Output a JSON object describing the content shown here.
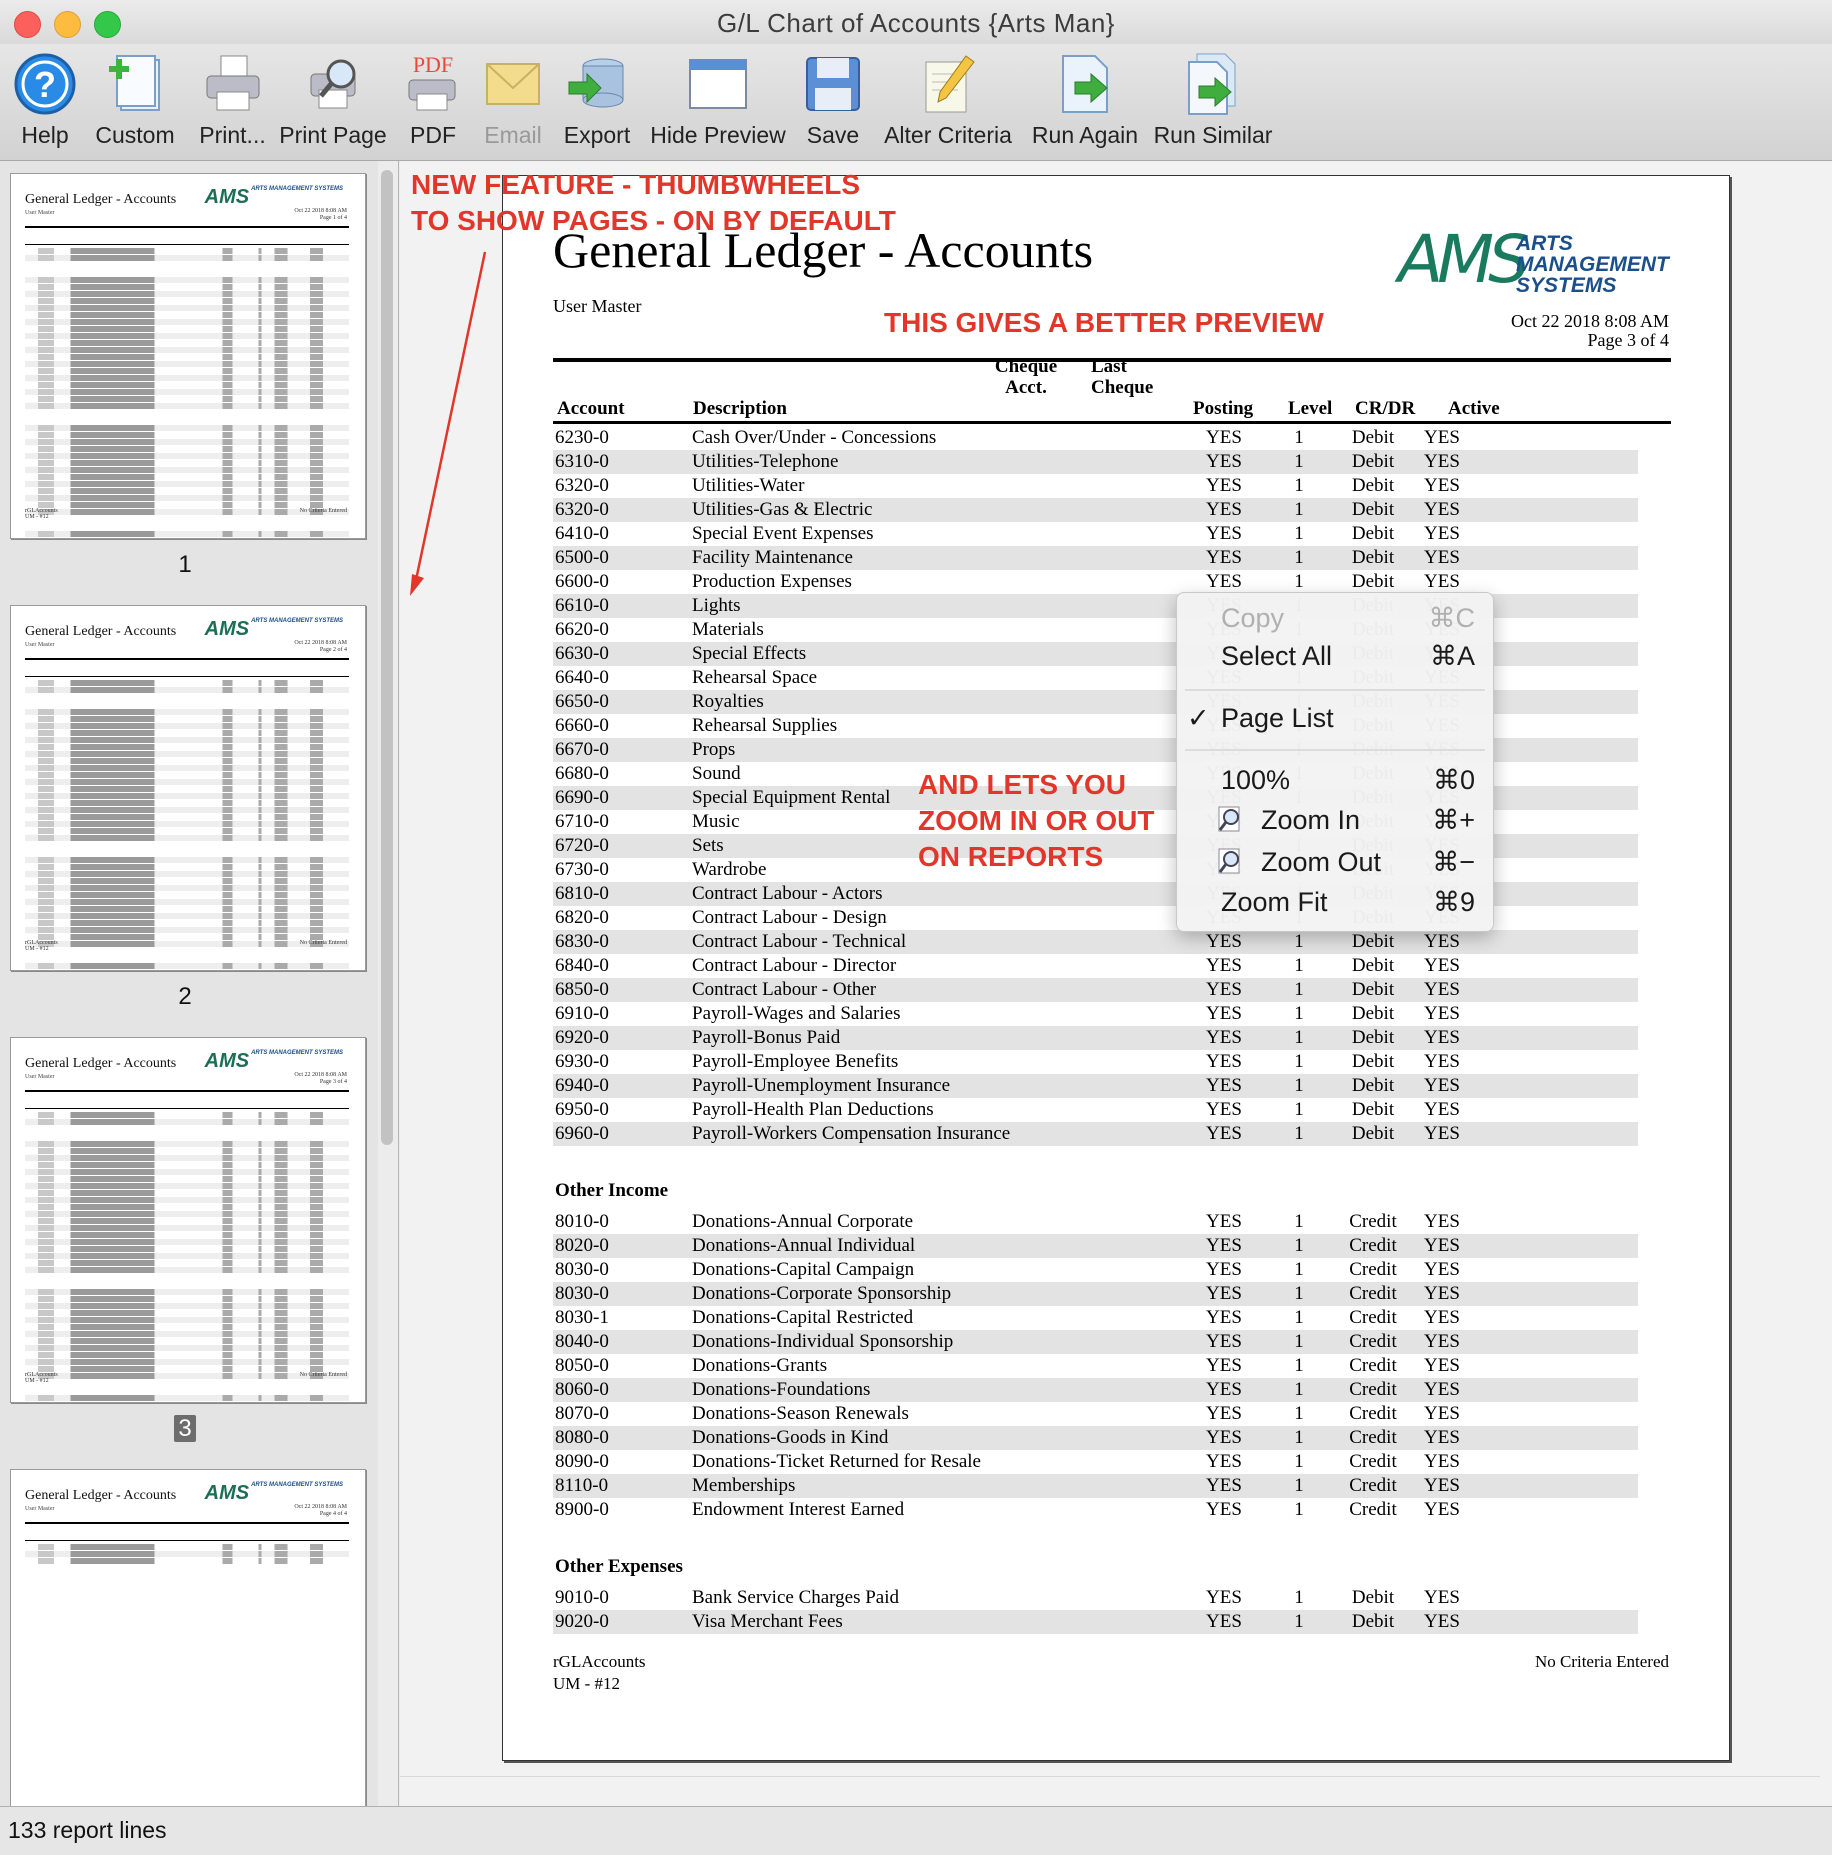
{
  "window": {
    "title": "G/L Chart of Accounts {Arts Man}",
    "traffic_colors": [
      "#fc605c",
      "#fdbc40",
      "#34c84a"
    ]
  },
  "toolbar": [
    {
      "label": "Help",
      "icon": "help-icon"
    },
    {
      "label": "Custom",
      "icon": "custom-icon"
    },
    {
      "label": "Print...",
      "icon": "printer-icon"
    },
    {
      "label": "Print Page",
      "icon": "print-page-icon"
    },
    {
      "label": "PDF",
      "icon": "pdf-icon"
    },
    {
      "label": "Email",
      "icon": "email-icon",
      "disabled": true
    },
    {
      "label": "Export",
      "icon": "export-icon"
    },
    {
      "label": "Hide Preview",
      "icon": "hide-preview-icon"
    },
    {
      "label": "Save",
      "icon": "save-icon"
    },
    {
      "label": "Alter Criteria",
      "icon": "alter-criteria-icon"
    },
    {
      "label": "Run Again",
      "icon": "run-again-icon"
    },
    {
      "label": "Run Similar",
      "icon": "run-similar-icon"
    }
  ],
  "thumbnails": {
    "title": "General Ledger - Accounts",
    "subtitle": "User Master",
    "logo_text": "AMS",
    "logo_words": "ARTS MANAGEMENT SYSTEMS",
    "footer_left": "rGLAccounts",
    "footer_left2": "UM - #12",
    "footer_right": "No Criteria Entered",
    "pages": [
      {
        "number": "1",
        "date": "Oct 22 2018 8:08 AM",
        "page_label": "Page 1 of 4"
      },
      {
        "number": "2",
        "date": "Oct 22 2018 8:08 AM",
        "page_label": "Page 2 of 4"
      },
      {
        "number": "3",
        "date": "Oct 22 2018 8:08 AM",
        "page_label": "Page 3 of 4",
        "selected": true
      },
      {
        "number": "4",
        "date": "Oct 22 2018 8:08 AM",
        "page_label": "Page 4 of 4"
      }
    ]
  },
  "report": {
    "title": "General Ledger - Accounts",
    "subtitle": "User Master",
    "logo_mark": "AMS",
    "logo_words": [
      "ARTS",
      "MANAGEMENT",
      "SYSTEMS"
    ],
    "date": "Oct 22 2018 8:08 AM",
    "page": "Page 3 of 4",
    "columns": {
      "account": "Account",
      "description": "Description",
      "cheque_acct_1": "Cheque",
      "cheque_acct_2": "Acct.",
      "last_cheque_1": "Last",
      "last_cheque_2": "Cheque",
      "posting": "Posting",
      "level": "Level",
      "crdr": "CR/DR",
      "active": "Active"
    },
    "sections": [
      {
        "name": "",
        "rows": [
          [
            "6230-0",
            "Cash Over/Under - Concessions",
            "YES",
            "1",
            "Debit",
            "YES"
          ],
          [
            "6310-0",
            "Utilities-Telephone",
            "YES",
            "1",
            "Debit",
            "YES"
          ],
          [
            "6320-0",
            "Utilities-Water",
            "YES",
            "1",
            "Debit",
            "YES"
          ],
          [
            "6320-0",
            "Utilities-Gas & Electric",
            "YES",
            "1",
            "Debit",
            "YES"
          ],
          [
            "6410-0",
            "Special Event Expenses",
            "YES",
            "1",
            "Debit",
            "YES"
          ],
          [
            "6500-0",
            "Facility Maintenance",
            "YES",
            "1",
            "Debit",
            "YES"
          ],
          [
            "6600-0",
            "Production Expenses",
            "YES",
            "1",
            "Debit",
            "YES"
          ],
          [
            "6610-0",
            "Lights",
            "YES",
            "1",
            "Debit",
            "YES"
          ],
          [
            "6620-0",
            "Materials",
            "YES",
            "1",
            "Debit",
            "YES"
          ],
          [
            "6630-0",
            "Special Effects",
            "YES",
            "1",
            "Debit",
            "YES"
          ],
          [
            "6640-0",
            "Rehearsal Space",
            "YES",
            "1",
            "Debit",
            "YES"
          ],
          [
            "6650-0",
            "Royalties",
            "YES",
            "1",
            "Debit",
            "YES"
          ],
          [
            "6660-0",
            "Rehearsal Supplies",
            "YES",
            "1",
            "Debit",
            "YES"
          ],
          [
            "6670-0",
            "Props",
            "YES",
            "1",
            "Debit",
            "YES"
          ],
          [
            "6680-0",
            "Sound",
            "YES",
            "1",
            "Debit",
            "YES"
          ],
          [
            "6690-0",
            "Special Equipment Rental",
            "YES",
            "1",
            "Debit",
            "YES"
          ],
          [
            "6710-0",
            "Music",
            "YES",
            "1",
            "Debit",
            "YES"
          ],
          [
            "6720-0",
            "Sets",
            "YES",
            "1",
            "Debit",
            "YES"
          ],
          [
            "6730-0",
            "Wardrobe",
            "YES",
            "1",
            "Debit",
            "YES"
          ],
          [
            "6810-0",
            "Contract Labour - Actors",
            "YES",
            "1",
            "Debit",
            "YES"
          ],
          [
            "6820-0",
            "Contract Labour - Design",
            "YES",
            "1",
            "Debit",
            "YES"
          ],
          [
            "6830-0",
            "Contract Labour - Technical",
            "YES",
            "1",
            "Debit",
            "YES"
          ],
          [
            "6840-0",
            "Contract Labour - Director",
            "YES",
            "1",
            "Debit",
            "YES"
          ],
          [
            "6850-0",
            "Contract Labour - Other",
            "YES",
            "1",
            "Debit",
            "YES"
          ],
          [
            "6910-0",
            "Payroll-Wages and Salaries",
            "YES",
            "1",
            "Debit",
            "YES"
          ],
          [
            "6920-0",
            "Payroll-Bonus Paid",
            "YES",
            "1",
            "Debit",
            "YES"
          ],
          [
            "6930-0",
            "Payroll-Employee Benefits",
            "YES",
            "1",
            "Debit",
            "YES"
          ],
          [
            "6940-0",
            "Payroll-Unemployment Insurance",
            "YES",
            "1",
            "Debit",
            "YES"
          ],
          [
            "6950-0",
            "Payroll-Health Plan Deductions",
            "YES",
            "1",
            "Debit",
            "YES"
          ],
          [
            "6960-0",
            "Payroll-Workers Compensation Insurance",
            "YES",
            "1",
            "Debit",
            "YES"
          ]
        ]
      },
      {
        "name": "Other Income",
        "rows": [
          [
            "8010-0",
            "Donations-Annual Corporate",
            "YES",
            "1",
            "Credit",
            "YES"
          ],
          [
            "8020-0",
            "Donations-Annual Individual",
            "YES",
            "1",
            "Credit",
            "YES"
          ],
          [
            "8030-0",
            "Donations-Capital Campaign",
            "YES",
            "1",
            "Credit",
            "YES"
          ],
          [
            "8030-0",
            "Donations-Corporate Sponsorship",
            "YES",
            "1",
            "Credit",
            "YES"
          ],
          [
            "8030-1",
            "Donations-Capital Restricted",
            "YES",
            "1",
            "Credit",
            "YES"
          ],
          [
            "8040-0",
            "Donations-Individual Sponsorship",
            "YES",
            "1",
            "Credit",
            "YES"
          ],
          [
            "8050-0",
            "Donations-Grants",
            "YES",
            "1",
            "Credit",
            "YES"
          ],
          [
            "8060-0",
            "Donations-Foundations",
            "YES",
            "1",
            "Credit",
            "YES"
          ],
          [
            "8070-0",
            "Donations-Season Renewals",
            "YES",
            "1",
            "Credit",
            "YES"
          ],
          [
            "8080-0",
            "Donations-Goods in Kind",
            "YES",
            "1",
            "Credit",
            "YES"
          ],
          [
            "8090-0",
            "Donations-Ticket Returned for Resale",
            "YES",
            "1",
            "Credit",
            "YES"
          ],
          [
            "8110-0",
            "Memberships",
            "YES",
            "1",
            "Credit",
            "YES"
          ],
          [
            "8900-0",
            "Endowment Interest Earned",
            "YES",
            "1",
            "Credit",
            "YES"
          ]
        ]
      },
      {
        "name": "Other Expenses",
        "rows": [
          [
            "9010-0",
            "Bank Service Charges Paid",
            "YES",
            "1",
            "Debit",
            "YES"
          ],
          [
            "9020-0",
            "Visa Merchant Fees",
            "YES",
            "1",
            "Debit",
            "YES"
          ]
        ]
      }
    ],
    "footer_left": "rGLAccounts",
    "footer_left2": "UM - #12",
    "footer_right": "No Criteria Entered"
  },
  "annotations": {
    "thumbwheels_line1": "NEW FEATURE - THUMBWHEELS",
    "thumbwheels_line2": "TO SHOW PAGES - ON BY DEFAULT",
    "better_preview": "THIS GIVES A BETTER PREVIEW",
    "zoom_line1": "AND LETS YOU",
    "zoom_line2": "ZOOM IN OR OUT",
    "zoom_line3": "ON REPORTS",
    "color": "#e2362b"
  },
  "context_menu": {
    "copy": {
      "label": "Copy",
      "shortcut": "⌘C",
      "disabled": true
    },
    "select_all": {
      "label": "Select All",
      "shortcut": "⌘A"
    },
    "page_list": {
      "label": "Page List",
      "checked": true,
      "check": "✓"
    },
    "zoom_100": {
      "label": "100%",
      "shortcut": "⌘0"
    },
    "zoom_in": {
      "label": "Zoom In",
      "shortcut": "⌘+",
      "icon": "zoom-in-icon"
    },
    "zoom_out": {
      "label": "Zoom Out",
      "shortcut": "⌘−",
      "icon": "zoom-out-icon"
    },
    "zoom_fit": {
      "label": "Zoom Fit",
      "shortcut": "⌘9"
    }
  },
  "status": {
    "text": "133 report lines"
  }
}
